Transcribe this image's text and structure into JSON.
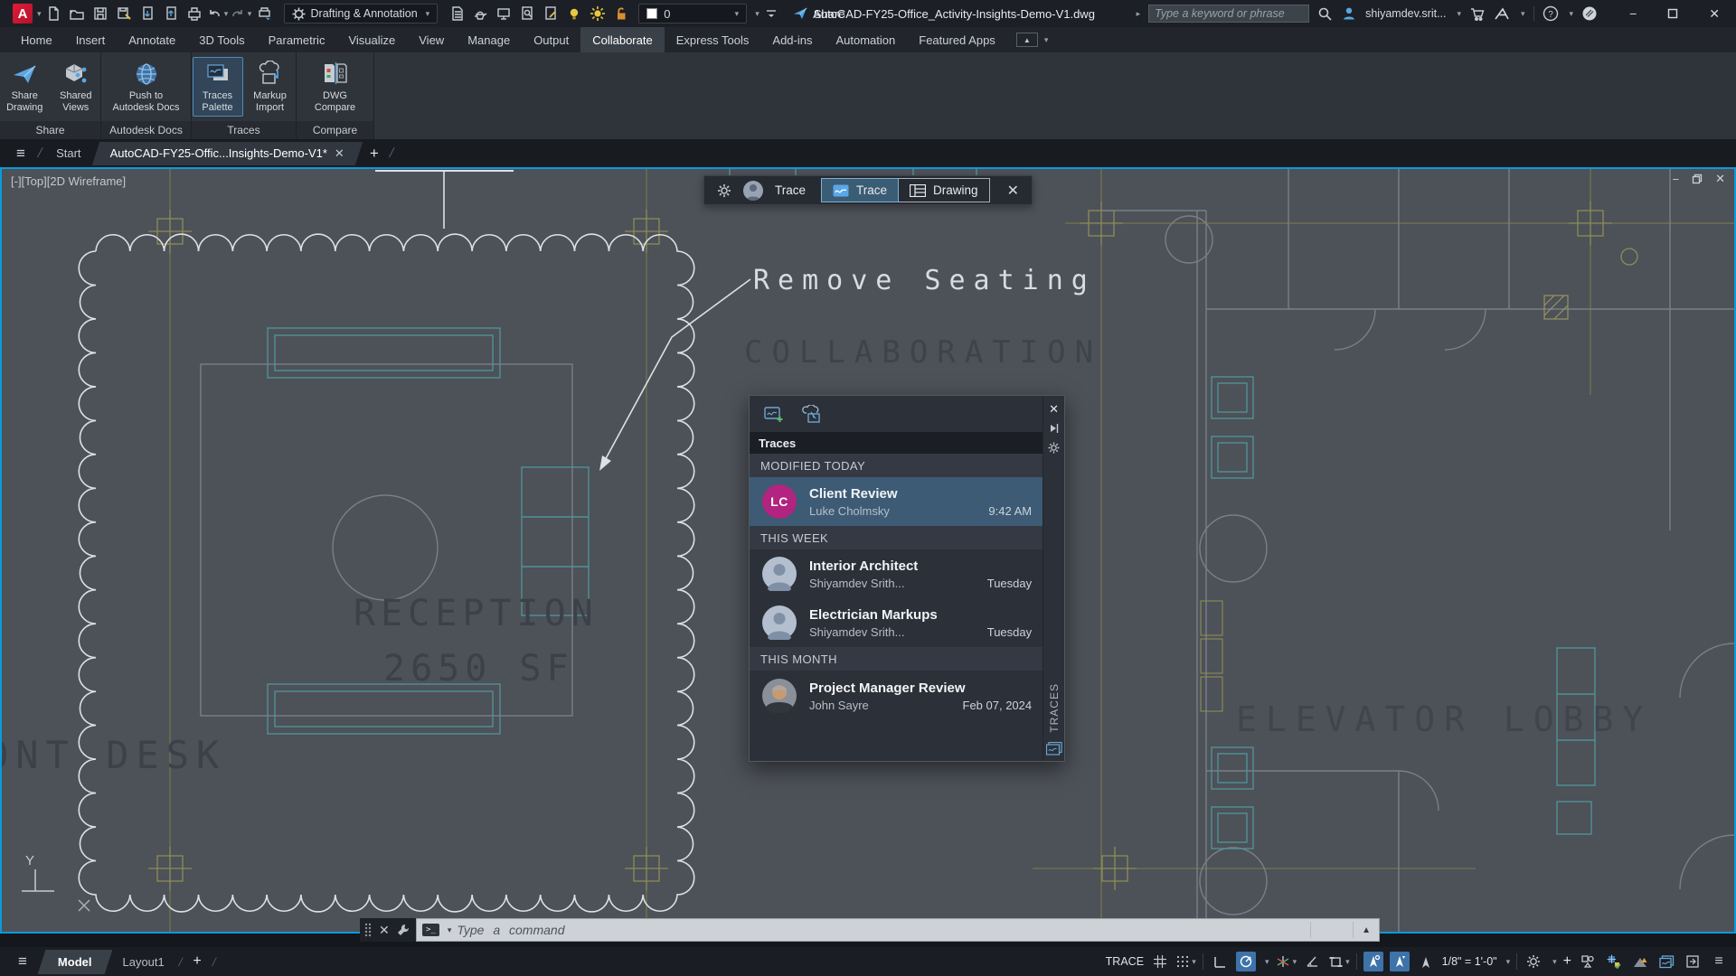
{
  "colors": {
    "accent_blue": "#0a9bdb",
    "selection_blue": "#3d5b74",
    "avatar_magenta": "#b1247f",
    "canvas_gray": "#4d5158",
    "teal_line": "#4f9296",
    "olive_line": "#8c8c55",
    "highlight_yellow": "#e8c63f"
  },
  "titlebar": {
    "workspace": "Drafting & Annotation",
    "layer_value": "0",
    "share_label": "Share",
    "title": "AutoCAD-FY25-Office_Activity-Insights-Demo-V1.dwg",
    "search_placeholder": "Type a keyword or phrase",
    "user_name": "shiyamdev.srit..."
  },
  "ribbon": {
    "tabs": [
      "Home",
      "Insert",
      "Annotate",
      "3D Tools",
      "Parametric",
      "Visualize",
      "View",
      "Manage",
      "Output",
      "Collaborate",
      "Express Tools",
      "Add-ins",
      "Automation",
      "Featured Apps"
    ],
    "active_tab": "Collaborate",
    "panels": [
      {
        "name": "Share",
        "buttons": [
          {
            "line1": "Share",
            "line2": "Drawing"
          },
          {
            "line1": "Shared",
            "line2": "Views"
          }
        ]
      },
      {
        "name": "Autodesk Docs",
        "buttons": [
          {
            "line1": "Push to",
            "line2": "Autodesk Docs"
          }
        ]
      },
      {
        "name": "Traces",
        "buttons": [
          {
            "line1": "Traces",
            "line2": "Palette"
          },
          {
            "line1": "Markup",
            "line2": "Import"
          }
        ]
      },
      {
        "name": "Compare",
        "buttons": [
          {
            "line1": "DWG",
            "line2": "Compare"
          }
        ]
      }
    ]
  },
  "file_tabs": {
    "start": "Start",
    "active": "AutoCAD-FY25-Offic...Insights-Demo-V1*"
  },
  "viewport": {
    "label": "[-][Top][2D Wireframe]"
  },
  "trace_toolbar": {
    "user": "Trace",
    "trace": "Trace",
    "drawing": "Drawing"
  },
  "palette": {
    "title": "Traces",
    "side_label": "TRACES",
    "sections": [
      {
        "header": "MODIFIED TODAY"
      },
      {
        "header": "THIS WEEK"
      },
      {
        "header": "THIS MONTH"
      }
    ],
    "items": [
      {
        "title": "Client Review",
        "author": "Luke Cholmsky",
        "when": "9:42 AM",
        "initials": "LC",
        "selected": true
      },
      {
        "title": "Interior Architect",
        "author": "Shiyamdev Srith...",
        "when": "Tuesday"
      },
      {
        "title": "Electrician Markups",
        "author": "Shiyamdev Srith...",
        "when": "Tuesday"
      },
      {
        "title": "Project Manager Review",
        "author": "John Sayre",
        "when": "Feb 07, 2024"
      }
    ]
  },
  "canvas_labels": {
    "annotation": "Remove Seating",
    "collaboration": "COLLABORATION",
    "reception": "RECEPTION",
    "reception_area": "2650 SF",
    "front_desk": "ONT DESK",
    "elevator_lobby": "ELEVATOR LOBBY",
    "ucs_y": "Y"
  },
  "command": {
    "placeholder": "Type a command"
  },
  "statusbar": {
    "model": "Model",
    "layout": "Layout1",
    "trace": "TRACE",
    "scale": "1/8\" = 1'-0\""
  }
}
